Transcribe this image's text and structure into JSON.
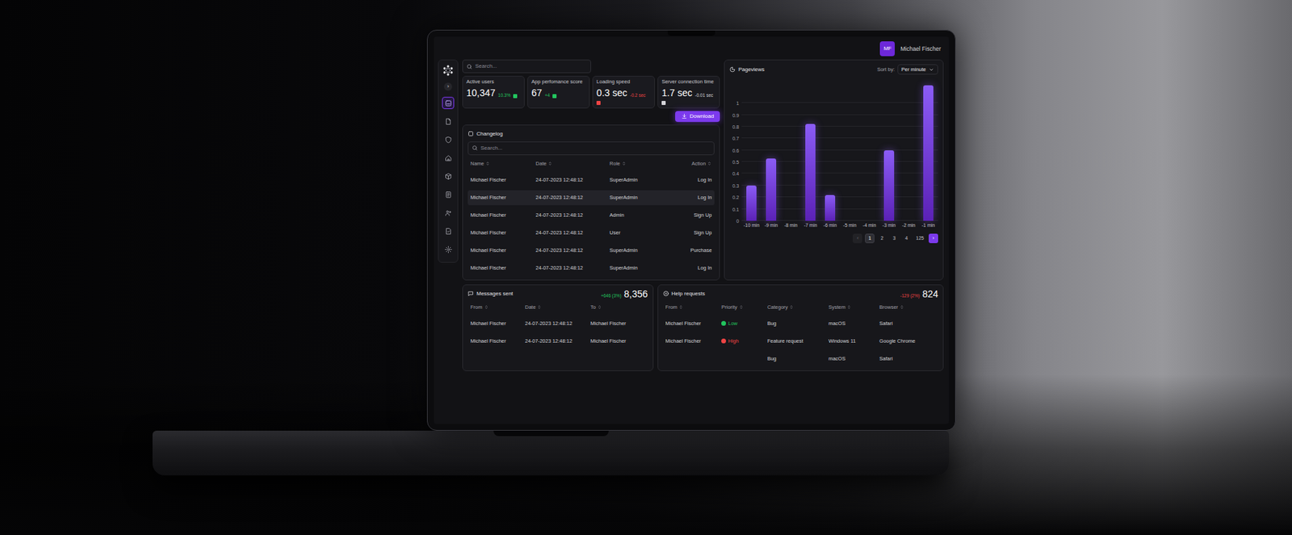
{
  "user": {
    "initials": "MF",
    "name": "Michael Fischer"
  },
  "sidebar": {
    "toggle": "›",
    "items": [
      {
        "selected": true
      },
      {
        "selected": false
      },
      {
        "selected": false
      },
      {
        "selected": false
      },
      {
        "selected": false
      },
      {
        "selected": false
      },
      {
        "selected": false
      },
      {
        "selected": false
      },
      {
        "selected": false
      }
    ]
  },
  "search": {
    "placeholder": "Search..."
  },
  "stats": [
    {
      "label": "Active users",
      "value": "10,347",
      "delta": "10.3%",
      "color": "#22c55e"
    },
    {
      "label": "App perfomance score",
      "value": "67",
      "delta": "+4",
      "color": "#22c55e"
    },
    {
      "label": "Loading speed",
      "value": "0.3 sec",
      "delta": "-0.2 sec",
      "color": "#ef4444"
    },
    {
      "label": "Server connection time",
      "value": "1.7 sec",
      "delta": "-0.01 sec",
      "color": "#d4d4d8"
    }
  ],
  "download": "Download",
  "changelog": {
    "title": "Changelog",
    "search_placeholder": "Search...",
    "columns": [
      "Name",
      "Date",
      "Role",
      "Action"
    ],
    "rows": [
      {
        "cells": [
          "Michael Fischer",
          "24-07-2023 12:48:12",
          "SuperAdmin",
          "Log In"
        ],
        "selected": false
      },
      {
        "cells": [
          "Michael Fischer",
          "24-07-2023 12:48:12",
          "SuperAdmin",
          "Log In"
        ],
        "selected": true
      },
      {
        "cells": [
          "Michael Fischer",
          "24-07-2023 12:48:12",
          "Admin",
          "Sign Up"
        ],
        "selected": false
      },
      {
        "cells": [
          "Michael Fischer",
          "24-07-2023 12:48:12",
          "User",
          "Sign Up"
        ],
        "selected": false
      },
      {
        "cells": [
          "Michael Fischer",
          "24-07-2023 12:48:12",
          "SuperAdmin",
          "Purchase"
        ],
        "selected": false
      },
      {
        "cells": [
          "Michael Fischer",
          "24-07-2023 12:48:12",
          "SuperAdmin",
          "Log In"
        ],
        "selected": false
      }
    ]
  },
  "pageviews": {
    "title": "Pageviews",
    "sort_label": "Sort by:",
    "sort_value": "Per minute",
    "y_ticks": [
      "0",
      "0.1",
      "0.2",
      "0.3",
      "0.4",
      "0.5",
      "0.6",
      "0.7",
      "0.8",
      "0.9",
      "1"
    ],
    "x_labels": [
      "-10 min",
      "-9 min",
      "-8 min",
      "-7 min",
      "-6 min",
      "-5 min",
      "-4 min",
      "-3 min",
      "-2 min",
      "-1 min"
    ],
    "values": [
      0.3,
      0.53,
      0,
      0.82,
      0.22,
      0,
      0,
      0.6,
      0,
      1.15
    ],
    "pagination": {
      "prev": {
        "label": "‹",
        "disabled": true
      },
      "pages": [
        {
          "label": "1",
          "selected": true
        },
        {
          "label": "2",
          "selected": false
        },
        {
          "label": "3",
          "selected": false
        },
        {
          "label": "4",
          "selected": false
        },
        {
          "label": "125",
          "selected": false
        }
      ],
      "next": {
        "label": "›",
        "disabled": false
      }
    }
  },
  "messages": {
    "title": "Messages sent",
    "delta": "+646 (3%)",
    "total": "8,356",
    "columns": [
      "From",
      "Date",
      "To"
    ],
    "rows": [
      [
        "Michael Fischer",
        "24-07-2023 12:48:12",
        "Michael Fischer"
      ],
      [
        "Michael Fischer",
        "24-07-2023 12:48:12",
        "Michael Fischer"
      ]
    ]
  },
  "help": {
    "title": "Help requests",
    "delta": "-129 (2%)",
    "total": "824",
    "columns": [
      "From",
      "Priority",
      "Category",
      "System",
      "Browser"
    ],
    "rows": [
      {
        "cells": [
          "Michael Fischer",
          "Low",
          "Bug",
          "macOS",
          "Safari"
        ],
        "priority_color": "#22c55e"
      },
      {
        "cells": [
          "Michael Fischer",
          "High",
          "Feature request",
          "Windows 11",
          "Google Chrome"
        ],
        "priority_color": "#ef4444"
      },
      {
        "cells": [
          "",
          "",
          "Bug",
          "macOS",
          "Safari"
        ]
      }
    ]
  }
}
